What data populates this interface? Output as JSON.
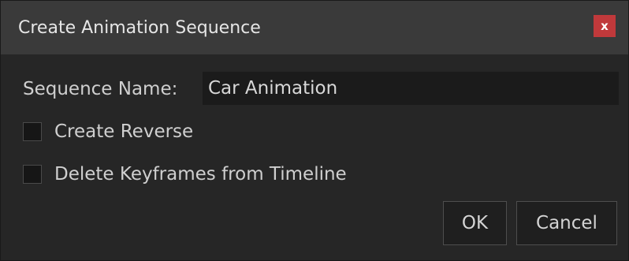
{
  "window": {
    "title": "Create Animation Sequence",
    "close_label": "x"
  },
  "form": {
    "sequence_name_label": "Sequence Name:",
    "sequence_name_value": "Car Animation",
    "create_reverse": {
      "label": "Create Reverse",
      "checked": false
    },
    "delete_keyframes": {
      "label": "Delete Keyframes from Timeline",
      "checked": false
    }
  },
  "buttons": {
    "ok_label": "OK",
    "cancel_label": "Cancel"
  },
  "colors": {
    "titlebar": "#3a3a3a",
    "body": "#262626",
    "close_button": "#c0393b",
    "input_background": "#1b1b1b",
    "text": "#cfcfcf"
  }
}
